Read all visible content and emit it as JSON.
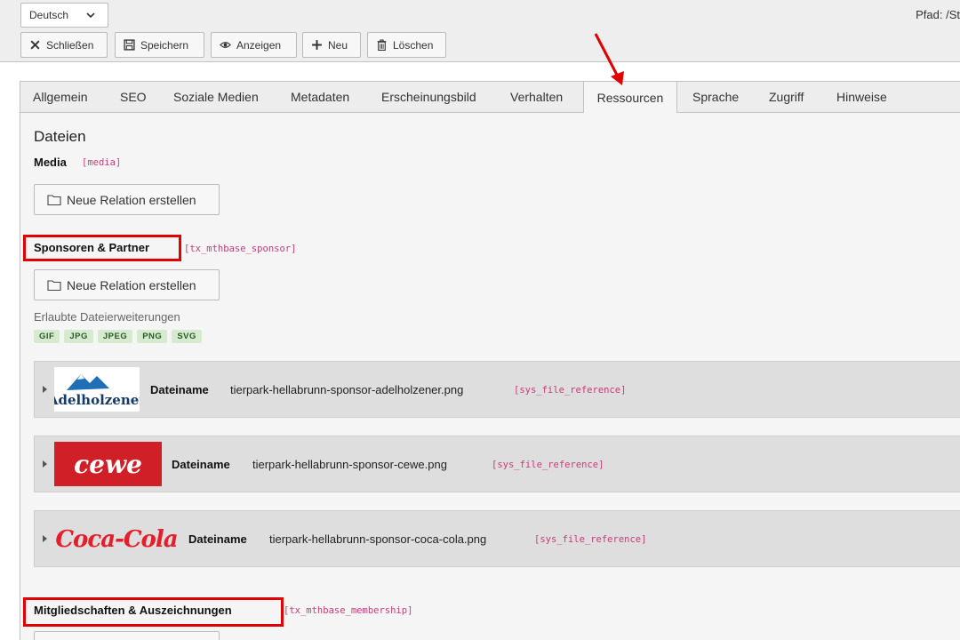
{
  "header": {
    "language": "Deutsch",
    "path": "Pfad: /St",
    "buttons": {
      "close": "Schließen",
      "save": "Speichern",
      "view": "Anzeigen",
      "new": "Neu",
      "delete": "Löschen"
    }
  },
  "tabs": [
    "Allgemein",
    "SEO",
    "Soziale Medien",
    "Metadaten",
    "Erscheinungsbild",
    "Verhalten",
    "Ressourcen",
    "Sprache",
    "Zugriff",
    "Hinweise"
  ],
  "active_tab": "Ressourcen",
  "section": {
    "title": "Dateien",
    "media": {
      "label": "Media",
      "key": "[media]",
      "button": "Neue Relation erstellen"
    },
    "sponsor": {
      "label": "Sponsoren & Partner",
      "key": "[tx_mthbase_sponsor]",
      "button": "Neue Relation erstellen",
      "allowed_label": "Erlaubte Dateierweiterungen",
      "extensions": [
        "GIF",
        "JPG",
        "JPEG",
        "PNG",
        "SVG"
      ],
      "files": [
        {
          "label": "Dateiname",
          "name": "tierpark-hellabrunn-sponsor-adelholzener.png",
          "key": "[sys_file_reference]",
          "logo_text": "Adelholzener"
        },
        {
          "label": "Dateiname",
          "name": "tierpark-hellabrunn-sponsor-cewe.png",
          "key": "[sys_file_reference]",
          "logo_text": "cewe"
        },
        {
          "label": "Dateiname",
          "name": "tierpark-hellabrunn-sponsor-coca-cola.png",
          "key": "[sys_file_reference]",
          "logo_text": "Coca-Cola"
        }
      ]
    },
    "membership": {
      "label": "Mitgliedschaften & Auszeichnungen",
      "key": "[tx_mthbase_membership]"
    }
  },
  "colors": {
    "highlight": "#e00000",
    "key_text": "#c83c78",
    "ext_badge": "#d6ead0"
  }
}
